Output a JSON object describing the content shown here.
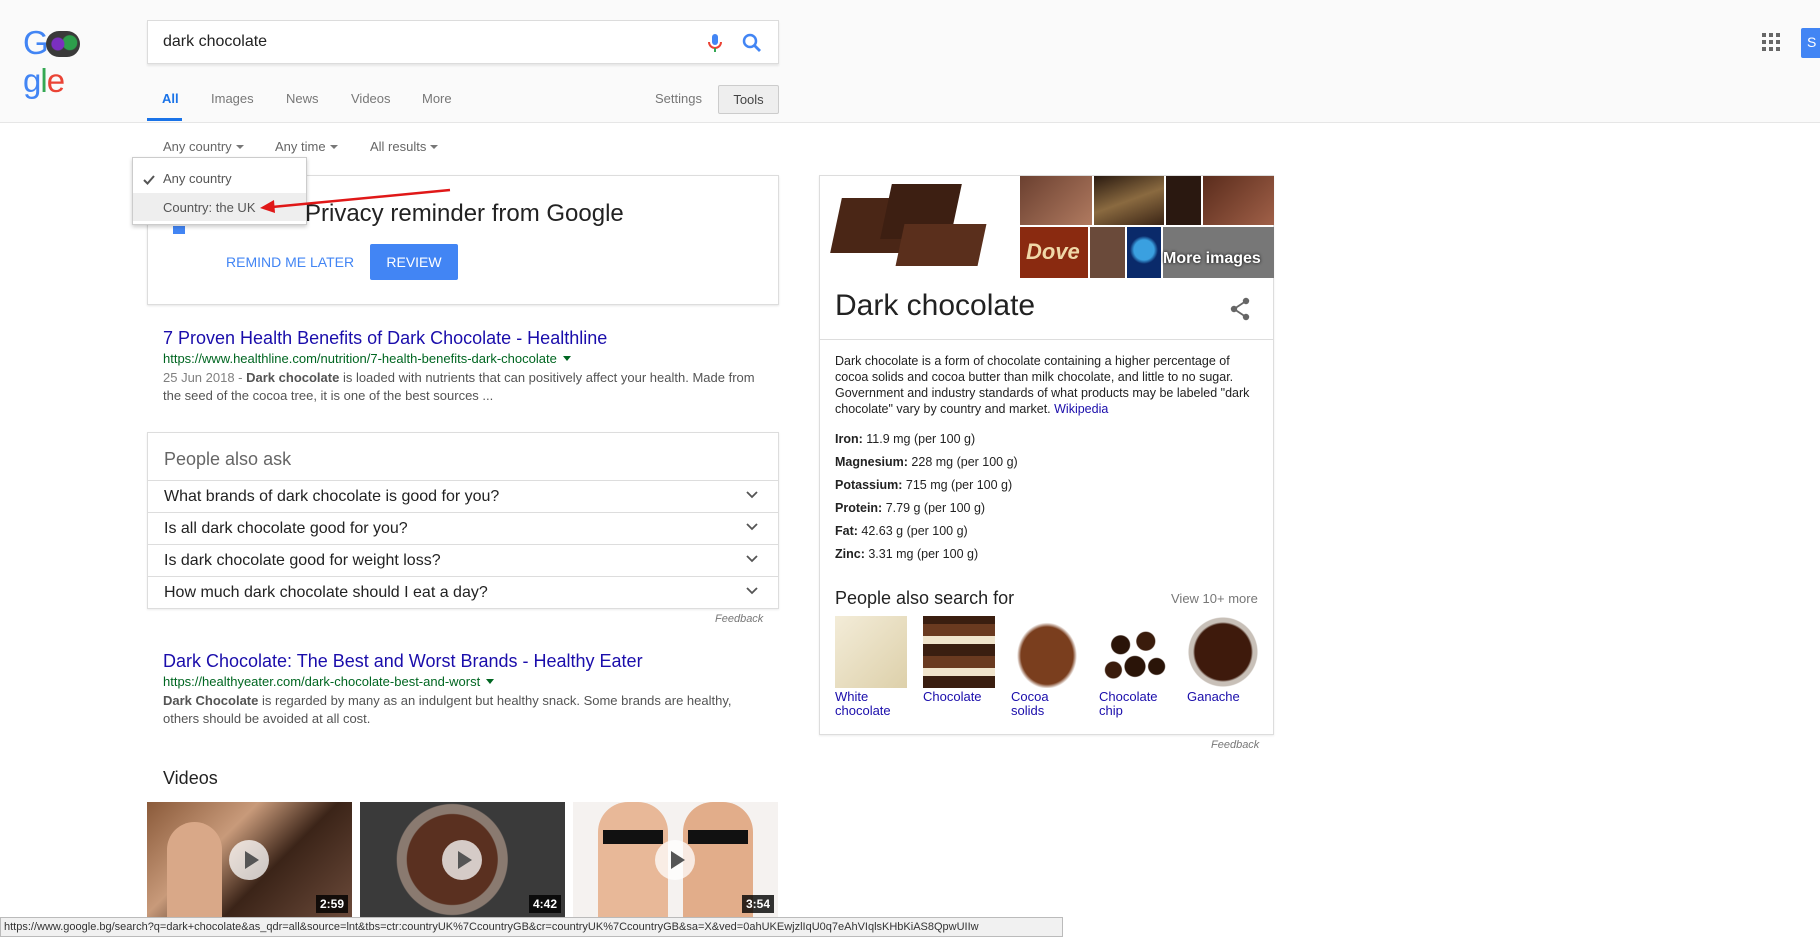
{
  "header": {
    "logo_text": "Google",
    "query": "dark chocolate",
    "signin_initial": "S"
  },
  "tabs": {
    "all": "All",
    "images": "Images",
    "news": "News",
    "videos": "Videos",
    "more": "More",
    "settings": "Settings",
    "tools": "Tools"
  },
  "filters": {
    "country": "Any country",
    "time": "Any time",
    "results": "All results"
  },
  "country_menu": {
    "items": [
      "Any country",
      "Country: the UK"
    ]
  },
  "privacy": {
    "title": "Privacy reminder from Google",
    "remind_later": "REMIND ME LATER",
    "review": "REVIEW"
  },
  "results": [
    {
      "title": "7 Proven Health Benefits of Dark Chocolate - Healthline",
      "url": "https://www.healthline.com/nutrition/7-health-benefits-dark-chocolate",
      "date": "25 Jun 2018 - ",
      "bold": "Dark chocolate",
      "snippet": " is loaded with nutrients that can positively affect your health. Made from the seed of the cocoa tree, it is one of the best sources ..."
    },
    {
      "title": "Dark Chocolate: The Best and Worst Brands - Healthy Eater",
      "url": "https://healthyeater.com/dark-chocolate-best-and-worst",
      "bold": "Dark Chocolate",
      "snippet": " is regarded by many as an indulgent but healthy snack. Some brands are healthy, others should be avoided at all cost."
    }
  ],
  "people_also_ask": {
    "title": "People also ask",
    "questions": [
      "What brands of dark chocolate is good for you?",
      "Is all dark chocolate good for you?",
      "Is dark chocolate good for weight loss?",
      "How much dark chocolate should I eat a day?"
    ],
    "feedback": "Feedback"
  },
  "videos": {
    "heading": "Videos",
    "durations": [
      "2:59",
      "4:42",
      "3:54"
    ]
  },
  "status_url": "https://www.google.bg/search?q=dark+chocolate&as_qdr=all&source=lnt&tbs=ctr:countryUK%7CcountryGB&cr=countryUK%7CcountryGB&sa=X&ved=0ahUKEwjzlIqU0q7eAhVIqlsKHbKiAS8QpwUIIw",
  "knowledge_panel": {
    "more_images": "More images",
    "title": "Dark chocolate",
    "description": "Dark chocolate is a form of chocolate containing a higher percentage of cocoa solids and cocoa butter than milk chocolate, and little to no sugar. Government and industry standards of what products may be labeled \"dark chocolate\" vary by country and market. ",
    "wiki": "Wikipedia",
    "facts": [
      {
        "label": "Iron:",
        "value": " 11.9 mg (per 100 g)"
      },
      {
        "label": "Magnesium:",
        "value": " 228 mg (per 100 g)"
      },
      {
        "label": "Potassium:",
        "value": " 715 mg (per 100 g)"
      },
      {
        "label": "Protein:",
        "value": " 7.79 g (per 100 g)"
      },
      {
        "label": "Fat:",
        "value": " 42.63 g (per 100 g)"
      },
      {
        "label": "Zinc:",
        "value": " 3.31 mg (per 100 g)"
      }
    ],
    "pas_title": "People also search for",
    "pas_more": "View 10+ more",
    "pas_items": [
      {
        "line1": "White",
        "line2": "chocolate"
      },
      {
        "line1": "Chocolate",
        "line2": ""
      },
      {
        "line1": "Cocoa",
        "line2": "solids"
      },
      {
        "line1": "Chocolate",
        "line2": "chip"
      },
      {
        "line1": "Ganache",
        "line2": ""
      }
    ],
    "feedback": "Feedback"
  },
  "colors": {
    "link": "#1a0dab",
    "url": "#006621",
    "accent": "#4285f4",
    "arrow": "#e01818"
  }
}
